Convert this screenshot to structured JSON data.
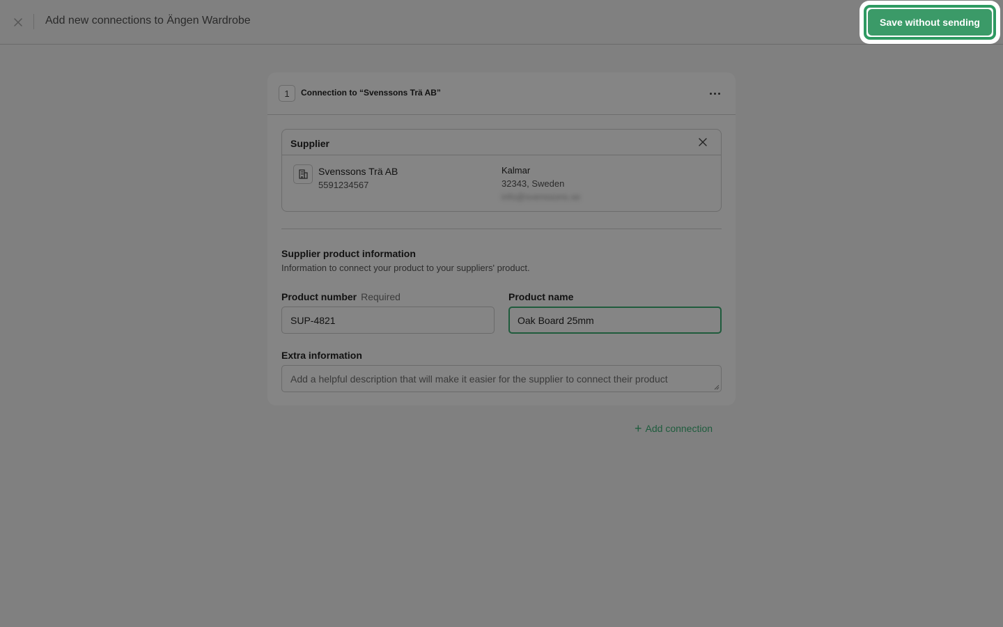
{
  "header": {
    "title": "Add new connections to Ängen Wardrobe",
    "close_icon": "close-icon",
    "save_label": "Save without sending",
    "accent_color": "#3b9a68"
  },
  "connection": {
    "number": "1",
    "title": "Connection to “Svenssons Trä AB”",
    "more_icon": "more-horizontal-icon",
    "supplier": {
      "label": "Supplier",
      "name": "Svenssons Trä AB",
      "org_number": "5591234567",
      "city": "Kalmar",
      "zip_country": "32343, Sweden",
      "email": "info@svenssons.se",
      "icon": "building-icon"
    },
    "product_info": {
      "title": "Supplier product information",
      "description": "Information to connect your product to your suppliers' product.",
      "product_number": {
        "label": "Product number",
        "required_label": "Required",
        "value": "SUP-4821"
      },
      "product_name": {
        "label": "Product name",
        "value": "Oak Board 25mm"
      },
      "extra_info": {
        "label": "Extra information",
        "placeholder": "Add a helpful description that will make it easier for the supplier to connect their product"
      }
    }
  },
  "add_connection_label": "Add connection"
}
